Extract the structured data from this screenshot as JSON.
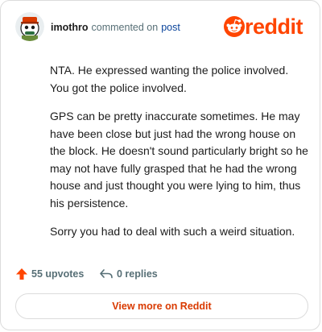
{
  "header": {
    "username": "imothro",
    "action_text": "commented on",
    "post_link": "post",
    "logo_text": "reddit"
  },
  "comment": {
    "paragraphs": [
      "NTA. He expressed wanting the police involved. You got the police involved.",
      "GPS can be pretty inaccurate sometimes. He may have been close but just had the wrong house on the block. He doesn't sound particularly bright so he may not have fully grasped that he had the wrong house and just thought you were lying to him, thus his persistence.",
      "Sorry you had to deal with such a weird situation."
    ]
  },
  "footer": {
    "upvotes": "55 upvotes",
    "replies": "0 replies"
  },
  "cta": {
    "label": "View more on Reddit"
  },
  "colors": {
    "brand": "#ff4500",
    "cta_text": "#d93a00",
    "link": "#0a449b",
    "muted": "#576f76"
  }
}
